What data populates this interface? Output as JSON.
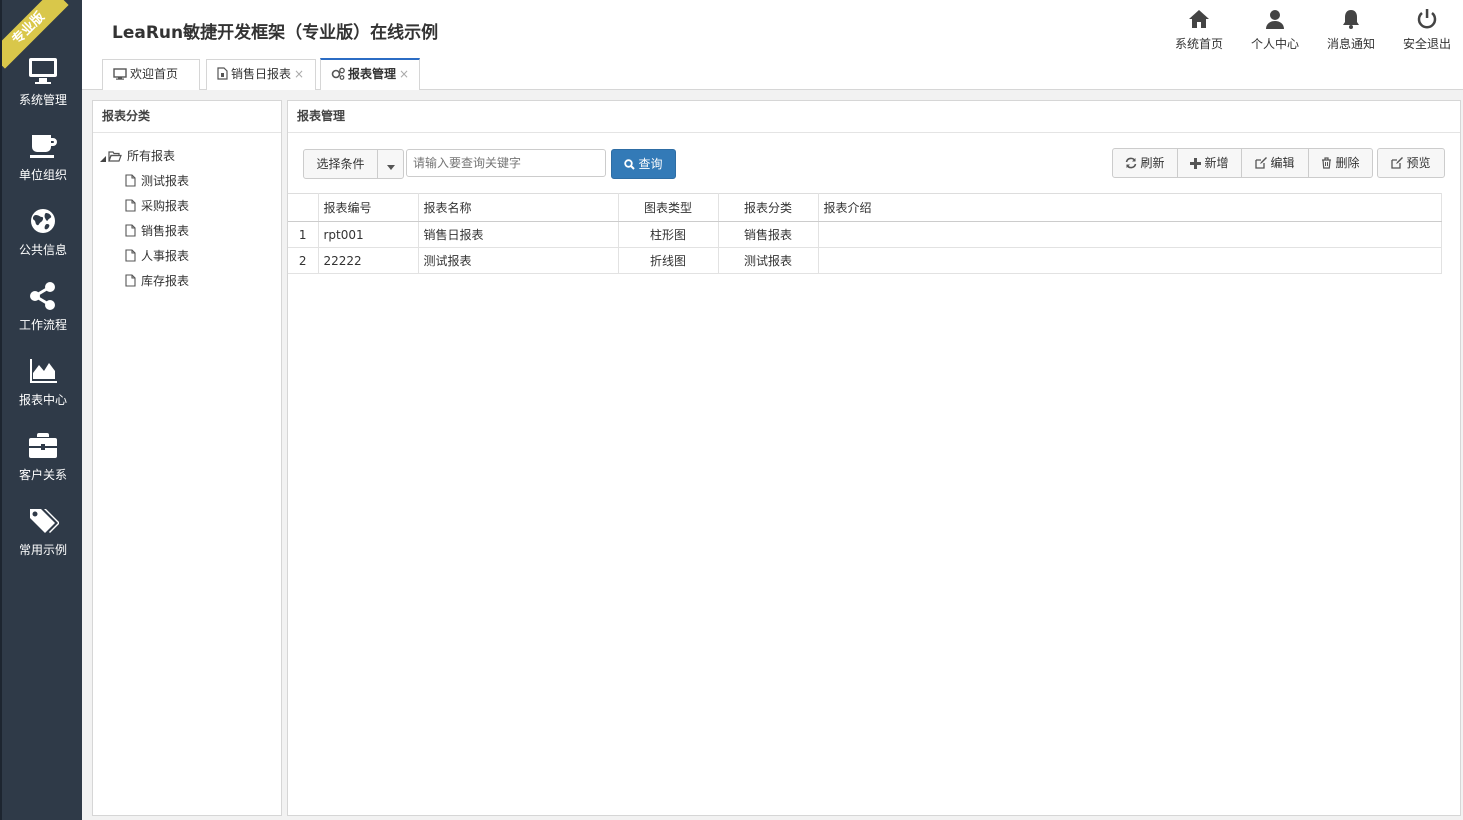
{
  "header": {
    "badge": "专业版",
    "title": "LeaRun敏捷开发框架（专业版）在线示例",
    "links": [
      {
        "label": "系统首页",
        "icon": "home-icon"
      },
      {
        "label": "个人中心",
        "icon": "user-icon"
      },
      {
        "label": "消息通知",
        "icon": "bell-icon"
      },
      {
        "label": "安全退出",
        "icon": "power-icon"
      }
    ]
  },
  "sidebar": {
    "items": [
      {
        "label": "系统管理",
        "icon": "monitor-icon"
      },
      {
        "label": "单位组织",
        "icon": "coffee-icon"
      },
      {
        "label": "公共信息",
        "icon": "globe-icon"
      },
      {
        "label": "工作流程",
        "icon": "share-icon"
      },
      {
        "label": "报表中心",
        "icon": "area-chart-icon"
      },
      {
        "label": "客户关系",
        "icon": "briefcase-icon"
      },
      {
        "label": "常用示例",
        "icon": "tags-icon"
      }
    ]
  },
  "tabs": [
    {
      "label": "欢迎首页",
      "icon": "desktop-icon",
      "closable": false
    },
    {
      "label": "销售日报表",
      "icon": "file-icon",
      "closable": true
    },
    {
      "label": "报表管理",
      "icon": "cogs-icon",
      "closable": true,
      "active": true
    }
  ],
  "left_panel": {
    "title": "报表分类",
    "root": "所有报表",
    "children": [
      "测试报表",
      "采购报表",
      "销售报表",
      "人事报表",
      "库存报表"
    ]
  },
  "right_panel": {
    "title": "报表管理",
    "condition_label": "选择条件",
    "search_placeholder": "请输入要查询关键字",
    "search_button": "查询",
    "toolbar": {
      "refresh": "刷新",
      "add": "新增",
      "edit": "编辑",
      "delete": "删除",
      "preview": "预览"
    },
    "table": {
      "columns": [
        "报表编号",
        "报表名称",
        "图表类型",
        "报表分类",
        "报表介绍"
      ],
      "rows": [
        {
          "num": "1",
          "code": "rpt001",
          "name": "销售日报表",
          "type": "柱形图",
          "category": "销售报表",
          "intro": ""
        },
        {
          "num": "2",
          "code": "22222",
          "name": "测试报表",
          "type": "折线图",
          "category": "测试报表",
          "intro": ""
        }
      ]
    }
  },
  "colors": {
    "sidebar_bg": "#2f3a48",
    "badge": "#d9c74a",
    "primary": "#2b6cc4"
  }
}
